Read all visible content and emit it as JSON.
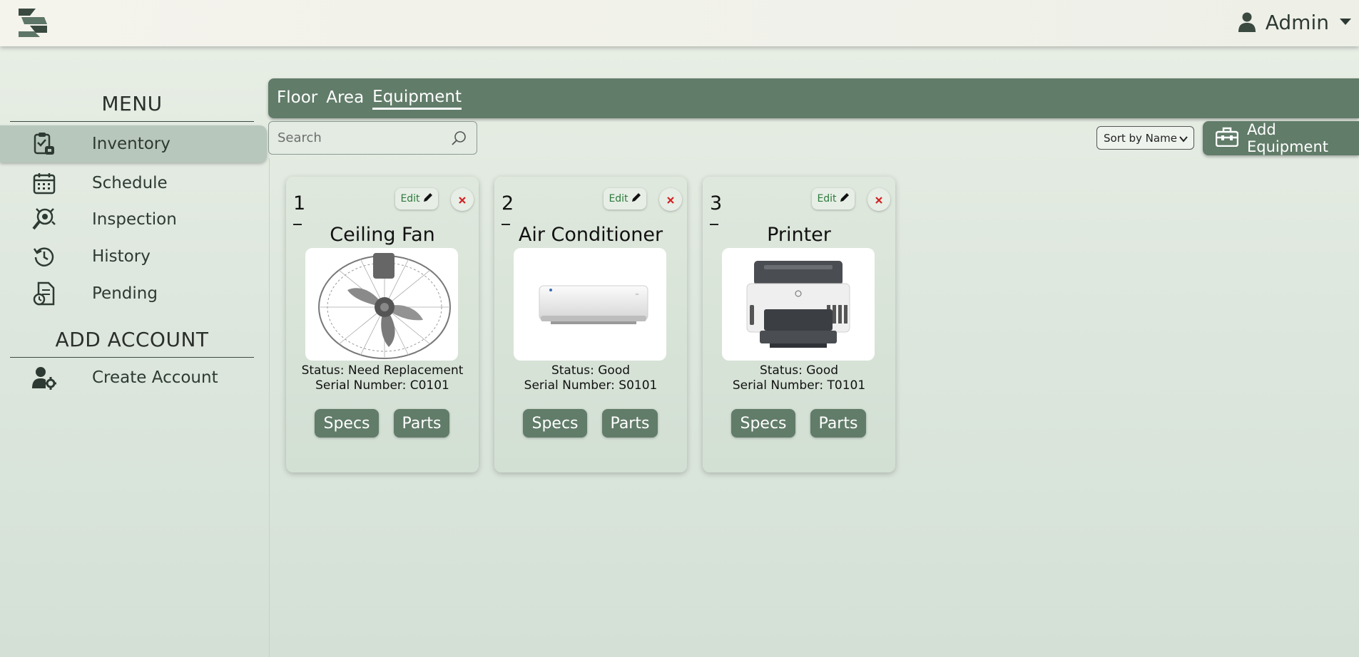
{
  "header": {
    "user_name": "Admin"
  },
  "sidebar": {
    "menu_heading": "MENU",
    "items": [
      {
        "label": "Inventory",
        "icon": "clipboard-check-icon",
        "active": true
      },
      {
        "label": "Schedule",
        "icon": "calendar-icon"
      },
      {
        "label": "Inspection",
        "icon": "inspection-icon"
      },
      {
        "label": "History",
        "icon": "history-icon"
      },
      {
        "label": "Pending",
        "icon": "pending-document-icon"
      }
    ],
    "account_heading": "ADD ACCOUNT",
    "account_items": [
      {
        "label": "Create Account",
        "icon": "user-gear-icon"
      }
    ]
  },
  "tabs": [
    {
      "label": "Floor"
    },
    {
      "label": "Area"
    },
    {
      "label": "Equipment",
      "active": true
    }
  ],
  "search": {
    "placeholder": "Search"
  },
  "sort": {
    "selected": "Sort by Name"
  },
  "add_button": {
    "label": "Add Equipment"
  },
  "cards": [
    {
      "number": "1",
      "title": "Ceiling Fan",
      "status": "Status: Need Replacement",
      "serial": "Serial Number: C0101",
      "edit_label": "Edit",
      "specs_label": "Specs",
      "parts_label": "Parts",
      "image": "ceiling-fan"
    },
    {
      "number": "2",
      "title": "Air Conditioner",
      "status": "Status: Good",
      "serial": "Serial Number: S0101",
      "edit_label": "Edit",
      "specs_label": "Specs",
      "parts_label": "Parts",
      "image": "air-conditioner"
    },
    {
      "number": "3",
      "title": "Printer",
      "status": "Status: Good",
      "serial": "Serial Number: T0101",
      "edit_label": "Edit",
      "specs_label": "Specs",
      "parts_label": "Parts",
      "image": "printer"
    }
  ],
  "colors": {
    "accent": "#617c69",
    "active_nav": "#b8c7bb",
    "edit_text": "#2d7a3c",
    "delete": "#d22222"
  }
}
